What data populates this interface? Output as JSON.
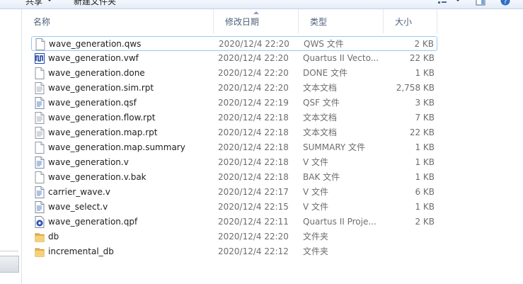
{
  "toolbar": {
    "share_label": "共享",
    "new_folder_label": "新建文件夹"
  },
  "columns": {
    "name": "名称",
    "date": "修改日期",
    "type": "类型",
    "size": "大小"
  },
  "files": [
    {
      "name": "wave_generation.qws",
      "date": "2020/12/4 22:20",
      "type": "QWS 文件",
      "size": "2 KB",
      "icon": "document-icon"
    },
    {
      "name": "wave_generation.vwf",
      "date": "2020/12/4 22:20",
      "type": "Quartus II Vecto...",
      "size": "22 KB",
      "icon": "waveform-file-icon"
    },
    {
      "name": "wave_generation.done",
      "date": "2020/12/4 22:20",
      "type": "DONE 文件",
      "size": "1 KB",
      "icon": "document-icon"
    },
    {
      "name": "wave_generation.sim.rpt",
      "date": "2020/12/4 22:20",
      "type": "文本文档",
      "size": "2,758 KB",
      "icon": "text-file-icon"
    },
    {
      "name": "wave_generation.qsf",
      "date": "2020/12/4 22:19",
      "type": "QSF 文件",
      "size": "3 KB",
      "icon": "script-file-icon"
    },
    {
      "name": "wave_generation.flow.rpt",
      "date": "2020/12/4 22:18",
      "type": "文本文档",
      "size": "7 KB",
      "icon": "text-file-icon"
    },
    {
      "name": "wave_generation.map.rpt",
      "date": "2020/12/4 22:18",
      "type": "文本文档",
      "size": "22 KB",
      "icon": "text-file-icon"
    },
    {
      "name": "wave_generation.map.summary",
      "date": "2020/12/4 22:18",
      "type": "SUMMARY 文件",
      "size": "1 KB",
      "icon": "document-icon"
    },
    {
      "name": "wave_generation.v",
      "date": "2020/12/4 22:18",
      "type": "V 文件",
      "size": "1 KB",
      "icon": "script-file-icon"
    },
    {
      "name": "wave_generation.v.bak",
      "date": "2020/12/4 22:18",
      "type": "BAK 文件",
      "size": "1 KB",
      "icon": "document-icon"
    },
    {
      "name": "carrier_wave.v",
      "date": "2020/12/4 22:17",
      "type": "V 文件",
      "size": "6 KB",
      "icon": "script-file-icon"
    },
    {
      "name": "wave_select.v",
      "date": "2020/12/4 22:15",
      "type": "V 文件",
      "size": "1 KB",
      "icon": "script-file-icon"
    },
    {
      "name": "wave_generation.qpf",
      "date": "2020/12/4 22:11",
      "type": "Quartus II Proje...",
      "size": "2 KB",
      "icon": "quartus-project-icon"
    },
    {
      "name": "db",
      "date": "2020/12/4 22:20",
      "type": "文件夹",
      "size": "",
      "icon": "folder-icon"
    },
    {
      "name": "incremental_db",
      "date": "2020/12/4 22:12",
      "type": "文件夹",
      "size": "",
      "icon": "folder-icon"
    }
  ],
  "selected_index": 0
}
